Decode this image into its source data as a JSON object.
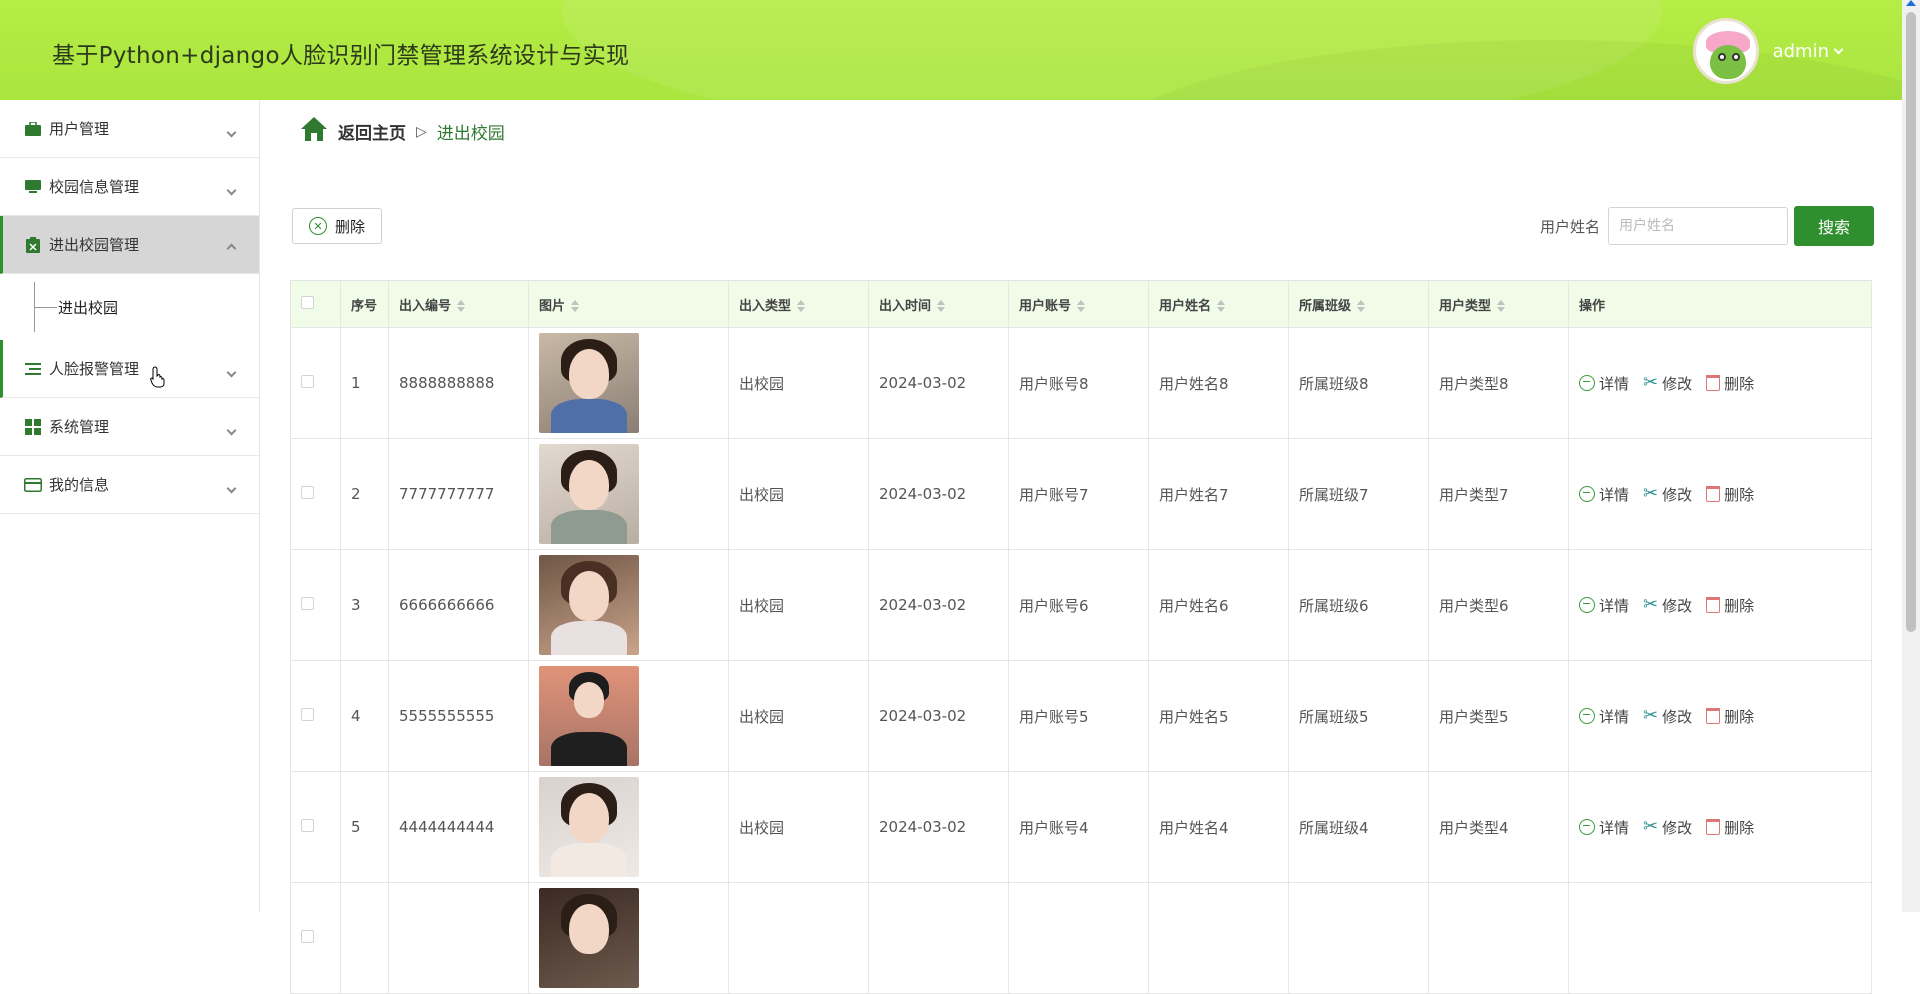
{
  "header": {
    "title": "基于Python+django人脸识别门禁管理系统设计与实现",
    "username": "admin"
  },
  "sidebar": {
    "items": [
      {
        "label": "用户管理",
        "icon": "briefcase-icon",
        "expanded": false
      },
      {
        "label": "校园信息管理",
        "icon": "monitor-icon",
        "expanded": false
      },
      {
        "label": "进出校园管理",
        "icon": "clipboard-icon",
        "expanded": true,
        "active": true
      },
      {
        "label": "人脸报警管理",
        "icon": "list-icon",
        "expanded": false
      },
      {
        "label": "系统管理",
        "icon": "grid-icon",
        "expanded": false
      },
      {
        "label": "我的信息",
        "icon": "card-icon",
        "expanded": false
      }
    ],
    "submenu": {
      "label": "进出校园"
    }
  },
  "breadcrumb": {
    "home": "返回主页",
    "current": "进出校园"
  },
  "toolbar": {
    "delete_label": "删除",
    "search_label": "用户姓名",
    "search_placeholder": "用户姓名",
    "search_button": "搜索"
  },
  "table": {
    "columns": [
      "序号",
      "出入编号",
      "图片",
      "出入类型",
      "出入时间",
      "用户账号",
      "用户姓名",
      "所属班级",
      "用户类型",
      "操作"
    ],
    "actions": {
      "detail": "详情",
      "edit": "修改",
      "delete": "删除"
    },
    "rows": [
      {
        "index": "1",
        "code": "8888888888",
        "type": "出校园",
        "time": "2024-03-02",
        "account": "用户账号8",
        "name": "用户姓名8",
        "class": "所属班级8",
        "utype": "用户类型8"
      },
      {
        "index": "2",
        "code": "7777777777",
        "type": "出校园",
        "time": "2024-03-02",
        "account": "用户账号7",
        "name": "用户姓名7",
        "class": "所属班级7",
        "utype": "用户类型7"
      },
      {
        "index": "3",
        "code": "6666666666",
        "type": "出校园",
        "time": "2024-03-02",
        "account": "用户账号6",
        "name": "用户姓名6",
        "class": "所属班级6",
        "utype": "用户类型6"
      },
      {
        "index": "4",
        "code": "5555555555",
        "type": "出校园",
        "time": "2024-03-02",
        "account": "用户账号5",
        "name": "用户姓名5",
        "class": "所属班级5",
        "utype": "用户类型5"
      },
      {
        "index": "5",
        "code": "4444444444",
        "type": "出校园",
        "time": "2024-03-02",
        "account": "用户账号4",
        "name": "用户姓名4",
        "class": "所属班级4",
        "utype": "用户类型4"
      }
    ]
  },
  "colors": {
    "header_green": "#b6ec46",
    "primary": "#2f8f2f",
    "table_header_bg": "#f0fbe8",
    "active_menu_bg": "#d6d6d6"
  }
}
